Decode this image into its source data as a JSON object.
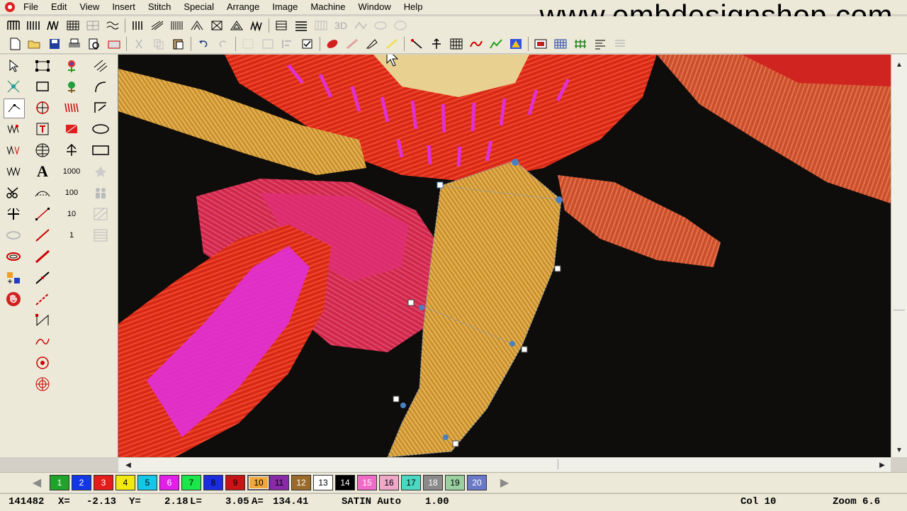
{
  "menu": {
    "items": [
      "File",
      "Edit",
      "View",
      "Insert",
      "Stitch",
      "Special",
      "Arrange",
      "Image",
      "Machine",
      "Window",
      "Help"
    ]
  },
  "watermark": "www.embdesignshop.com",
  "toolbar": {
    "threed_label": "3D"
  },
  "tools": {
    "num_1000": "1000",
    "num_100": "100",
    "num_10": "10",
    "num_1": "1",
    "text_tool": "A"
  },
  "palette": {
    "colors": [
      {
        "num": "1",
        "color": "#1fa32a"
      },
      {
        "num": "2",
        "color": "#1237e6"
      },
      {
        "num": "3",
        "color": "#e51c1c"
      },
      {
        "num": "4",
        "color": "#f2e812"
      },
      {
        "num": "5",
        "color": "#14c7e8"
      },
      {
        "num": "6",
        "color": "#e11fe8"
      },
      {
        "num": "7",
        "color": "#1be64a"
      },
      {
        "num": "8",
        "color": "#1b2be0"
      },
      {
        "num": "9",
        "color": "#c81414"
      },
      {
        "num": "10",
        "color": "#f0a83a"
      },
      {
        "num": "11",
        "color": "#8a2aa8"
      },
      {
        "num": "12",
        "color": "#9a6a2a"
      },
      {
        "num": "13",
        "color": "#ffffff"
      },
      {
        "num": "14",
        "color": "#000000"
      },
      {
        "num": "15",
        "color": "#f06ac8"
      },
      {
        "num": "16",
        "color": "#f0a8c8"
      },
      {
        "num": "17",
        "color": "#4ad8c0"
      },
      {
        "num": "18",
        "color": "#8a8a8a"
      },
      {
        "num": "19",
        "color": "#9ad0a0"
      },
      {
        "num": "20",
        "color": "#6a78c8"
      }
    ],
    "selected": "10"
  },
  "status": {
    "stitch_count": "141482",
    "x_label": "X=",
    "x_value": "-2.13",
    "y_label": "Y=",
    "y_value": "2.18",
    "l_label": "L=",
    "l_value": "3.05",
    "a_label": "A=",
    "a_value": "134.41",
    "stitch_type": "SATIN Auto",
    "density": "1.00",
    "col": "Col 10",
    "zoom": "Zoom 6.6"
  }
}
